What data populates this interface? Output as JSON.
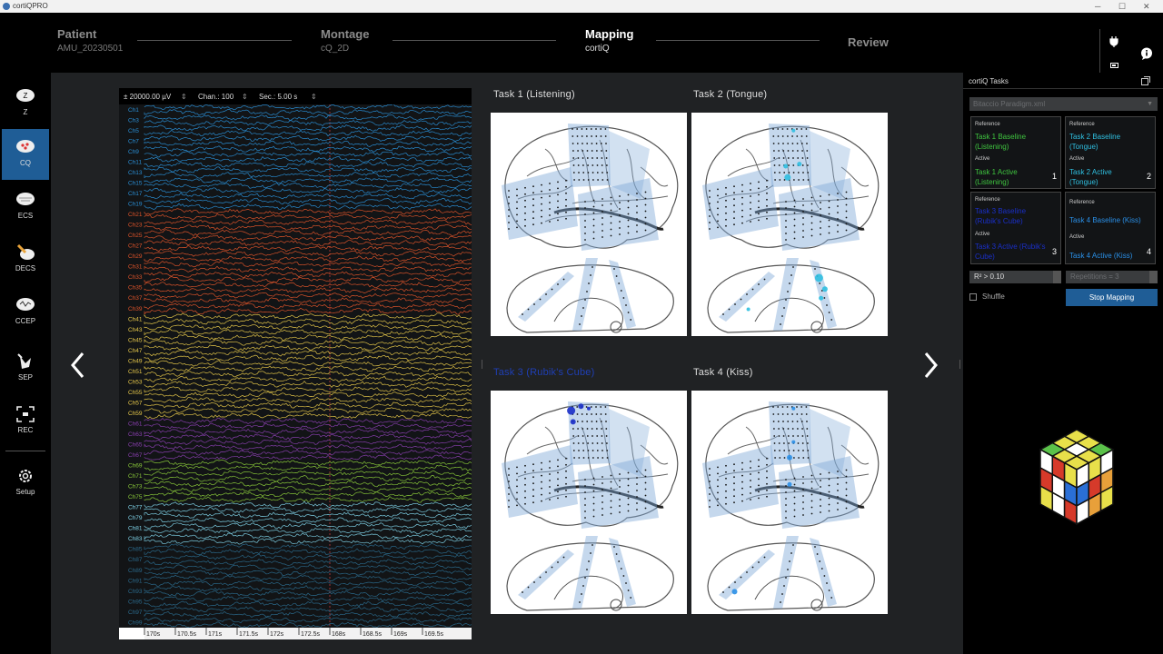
{
  "app": {
    "title": "cortiQPRO"
  },
  "steps": [
    {
      "title": "Patient",
      "value": "AMU_20230501"
    },
    {
      "title": "Montage",
      "value": "cQ_2D"
    },
    {
      "title": "Mapping",
      "value": "cortiQ"
    },
    {
      "title": "Review",
      "value": ""
    }
  ],
  "sidebar": {
    "items": [
      {
        "label": "Z"
      },
      {
        "label": "CQ"
      },
      {
        "label": "ECS"
      },
      {
        "label": "DECS"
      },
      {
        "label": "CCEP"
      },
      {
        "label": "SEP"
      },
      {
        "label": "REC"
      },
      {
        "label": "Setup"
      }
    ]
  },
  "eeg": {
    "amplitude": "± 20000.00 µV",
    "channels": "Chan.: 100",
    "seconds": "Sec.: 5.00 s",
    "channel_labels": [
      "Ch1",
      "Ch3",
      "Ch5",
      "Ch7",
      "Ch9",
      "Ch11",
      "Ch13",
      "Ch15",
      "Ch17",
      "Ch19",
      "Ch21",
      "Ch23",
      "Ch25",
      "Ch27",
      "Ch29",
      "Ch31",
      "Ch33",
      "Ch35",
      "Ch37",
      "Ch39",
      "Ch41",
      "Ch43",
      "Ch45",
      "Ch47",
      "Ch49",
      "Ch51",
      "Ch53",
      "Ch55",
      "Ch57",
      "Ch59",
      "Ch61",
      "Ch63",
      "Ch65",
      "Ch67",
      "Ch69",
      "Ch71",
      "Ch73",
      "Ch75",
      "Ch77",
      "Ch79",
      "Ch81",
      "Ch83",
      "Ch85",
      "Ch87",
      "Ch89",
      "Ch91",
      "Ch93",
      "Ch95",
      "Ch97",
      "Ch99"
    ],
    "time_labels": [
      "170s",
      "170.5s",
      "171s",
      "171.5s",
      "172s",
      "172.5s",
      "168s",
      "168.5s",
      "169s",
      "169.5s"
    ],
    "colors": {
      "blue": "#2a8fd6",
      "red": "#e0542a",
      "yellow": "#e8c94a",
      "purple": "#8a3fb0",
      "green": "#8bcb3a",
      "cyan": "#7fd3e8",
      "dim": "#2b6a8c"
    }
  },
  "tasks": [
    {
      "title": "Task 1  (Listening)",
      "dots": []
    },
    {
      "title": "Task 2  (Tongue)",
      "dots": [
        [
          0.52,
          0.08,
          2
        ],
        [
          0.48,
          0.24,
          2.5
        ],
        [
          0.55,
          0.23,
          2.5
        ],
        [
          0.49,
          0.29,
          3.5
        ],
        [
          0.65,
          0.74,
          4.5
        ],
        [
          0.68,
          0.79,
          3
        ],
        [
          0.66,
          0.83,
          2.5
        ],
        [
          0.29,
          0.88,
          2
        ]
      ]
    },
    {
      "title": "Task 3 (Rubik's Cube)",
      "dots": [
        [
          0.41,
          0.09,
          4.5
        ],
        [
          0.46,
          0.07,
          3
        ],
        [
          0.42,
          0.14,
          3
        ],
        [
          0.5,
          0.08,
          2
        ]
      ]
    },
    {
      "title": "Task 4  (Kiss)",
      "dots": [
        [
          0.52,
          0.08,
          2
        ],
        [
          0.52,
          0.23,
          2
        ],
        [
          0.5,
          0.3,
          3
        ],
        [
          0.5,
          0.42,
          2.5
        ],
        [
          0.22,
          0.9,
          3
        ]
      ]
    }
  ],
  "panel": {
    "title": "cortiQ Tasks",
    "paradigm": "Bitaccio Paradigm.xml",
    "reference_label": "Reference",
    "active_label": "Active",
    "cards": [
      {
        "reference": "Task 1 Baseline (Listening)",
        "active": "Task 1 Active (Listening)",
        "num": "1",
        "color": "#3fc43f"
      },
      {
        "reference": "Task 2 Baseline (Tongue)",
        "active": "Task 2 Active (Tongue)",
        "num": "2",
        "color": "#2fbfe0"
      },
      {
        "reference": "Task 3 Baseline (Rubik's Cube)",
        "active": "Task 3 Active (Rubik's Cube)",
        "num": "3",
        "color": "#1a2fc8"
      },
      {
        "reference": "Task 4 Baseline (Kiss)",
        "active": "Task 4 Active (Kiss)",
        "num": "4",
        "color": "#2a8fe6"
      }
    ],
    "r2": "R² > 0.10",
    "repetitions": "Repetitions = 3",
    "shuffle": "Shuffle",
    "stop": "Stop Mapping"
  }
}
